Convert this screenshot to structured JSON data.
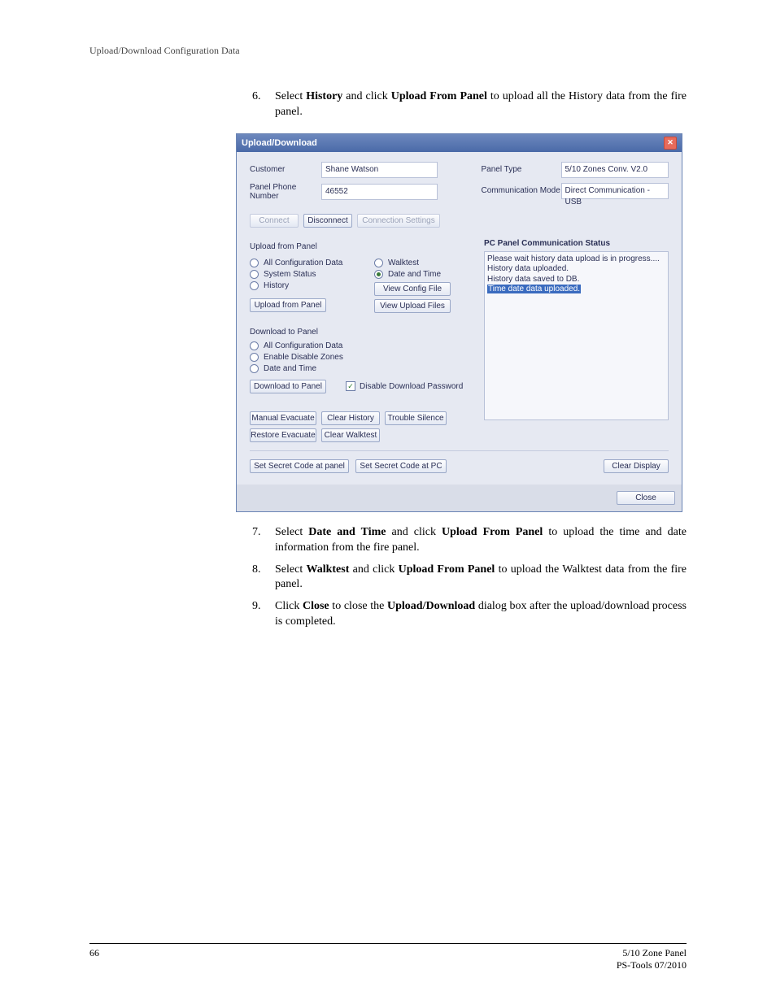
{
  "header": {
    "text": "Upload/Download Configuration Data"
  },
  "steps": {
    "s6": {
      "n": "6.",
      "t1": "Select ",
      "b1": "History",
      "t2": " and click ",
      "b2": "Upload From Panel",
      "t3": " to upload all the History data from the fire panel."
    },
    "s7": {
      "n": "7.",
      "t1": "Select ",
      "b1": "Date and Time",
      "t2": " and click ",
      "b2": "Upload From Panel",
      "t3": " to upload the time and date information from the fire panel."
    },
    "s8": {
      "n": "8.",
      "t1": "Select ",
      "b1": "Walktest",
      "t2": " and click ",
      "b2": "Upload From Panel",
      "t3": " to upload the Walktest data from the fire panel."
    },
    "s9": {
      "n": "9.",
      "t1": "Click ",
      "b1": "Close",
      "t2": " to close the ",
      "b2": "Upload/Download",
      "t3": " dialog box after the upload/download process is completed."
    }
  },
  "dialog": {
    "title": "Upload/Download",
    "customer_l": "Customer",
    "customer_v": "Shane Watson",
    "phone_l": "Panel Phone Number",
    "phone_v": "46552",
    "ptype_l": "Panel Type",
    "ptype_v": "5/10 Zones Conv. V2.0",
    "cmode_l": "Communication Mode",
    "cmode_v": "Direct Communication - USB",
    "connect": "Connect",
    "disconnect": "Disconnect",
    "connset": "Connection Settings",
    "upload_title": "Upload from Panel",
    "r_allcfg": "All Configuration Data",
    "r_sys": "System Status",
    "r_hist": "History",
    "r_walk": "Walktest",
    "r_dt": "Date and Time",
    "view_cfg": "View Config File",
    "view_upl": "View Upload Files",
    "upload_btn": "Upload from Panel",
    "download_title": "Download to Panel",
    "r_dl_all": "All Configuration Data",
    "r_dl_edz": "Enable Disable Zones",
    "r_dl_dt": "Date and Time",
    "download_btn": "Download to Panel",
    "disable_dl_pw": "Disable Download Password",
    "manual_evac": "Manual Evacuate",
    "clear_hist": "Clear History",
    "trouble_silence": "Trouble Silence",
    "restore_evac": "Restore Evacuate",
    "clear_walk": "Clear Walktest",
    "set_panel": "Set Secret Code at panel",
    "set_pc": "Set Secret Code at PC",
    "pc_title": "PC Panel Communication Status",
    "pc_l1": "Please wait history data upload is in progress....",
    "pc_l2": "History data uploaded.",
    "pc_l3": "History data saved to DB.",
    "pc_l4": "Time date data uploaded.",
    "clear_disp": "Clear Display",
    "close": "Close"
  },
  "footer": {
    "page": "66",
    "r1": "5/10 Zone Panel",
    "r2": "PS-Tools 07/2010"
  }
}
